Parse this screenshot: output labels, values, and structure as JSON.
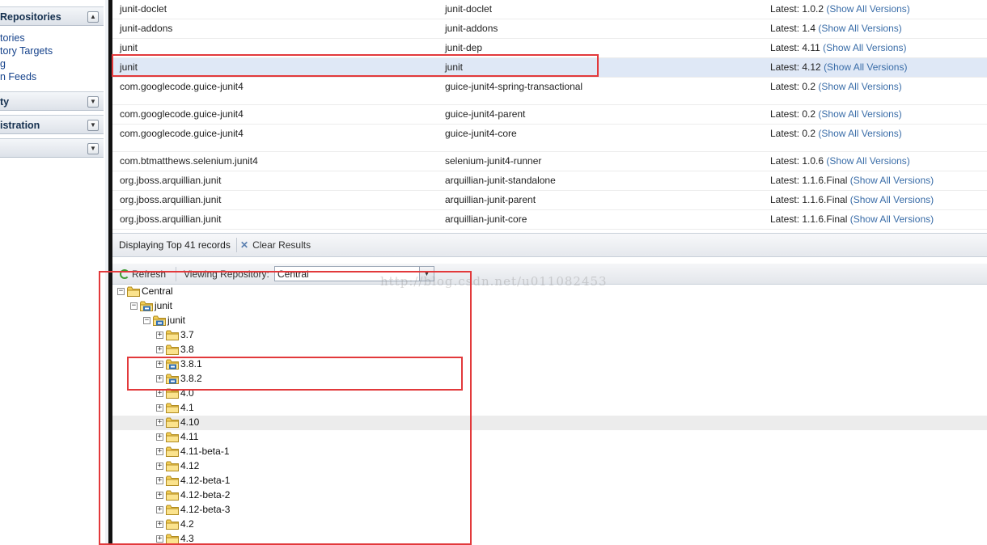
{
  "nav": {
    "repositories_header": "Repositories",
    "links": [
      "tories",
      "tory Targets",
      "g",
      "n Feeds"
    ],
    "security_header": "ty",
    "administration_header": "istration",
    "blank_header": ""
  },
  "results": {
    "latest_prefix": "Latest: ",
    "show_all_label": "(Show All Versions)",
    "rows": [
      {
        "group": "junit-doclet",
        "artifact": "junit-doclet",
        "version": "1.0.2"
      },
      {
        "group": "junit-addons",
        "artifact": "junit-addons",
        "version": "1.4"
      },
      {
        "group": "junit",
        "artifact": "junit-dep",
        "version": "4.11"
      },
      {
        "group": "junit",
        "artifact": "junit",
        "version": "4.12",
        "selected": true
      },
      {
        "group": "com.googlecode.guice-junit4",
        "artifact": "guice-junit4-spring-transactional",
        "version": "0.2"
      },
      {
        "group": "com.googlecode.guice-junit4",
        "artifact": "guice-junit4-parent",
        "version": "0.2"
      },
      {
        "group": "com.googlecode.guice-junit4",
        "artifact": "guice-junit4-core",
        "version": "0.2"
      },
      {
        "group": "com.btmatthews.selenium.junit4",
        "artifact": "selenium-junit4-runner",
        "version": "1.0.6"
      },
      {
        "group": "org.jboss.arquillian.junit",
        "artifact": "arquillian-junit-standalone",
        "version": "1.1.6.Final"
      },
      {
        "group": "org.jboss.arquillian.junit",
        "artifact": "arquillian-junit-parent",
        "version": "1.1.6.Final"
      },
      {
        "group": "org.jboss.arquillian.junit",
        "artifact": "arquillian-junit-core",
        "version": "1.1.6.Final"
      }
    ]
  },
  "paging": {
    "display_text": "Displaying Top 41 records",
    "clear_label": "Clear Results"
  },
  "tree_toolbar": {
    "refresh_label": "Refresh",
    "viewing_label": "Viewing Repository:",
    "repository_value": "Central"
  },
  "tree": {
    "nodes": [
      {
        "label": "Central",
        "depth": 0,
        "expanded": true
      },
      {
        "label": "junit",
        "depth": 1,
        "expanded": true,
        "badge": true
      },
      {
        "label": "junit",
        "depth": 2,
        "expanded": true,
        "badge": true
      },
      {
        "label": "3.7",
        "depth": 3
      },
      {
        "label": "3.8",
        "depth": 3
      },
      {
        "label": "3.8.1",
        "depth": 3,
        "badge": true
      },
      {
        "label": "3.8.2",
        "depth": 3,
        "badge": true
      },
      {
        "label": "4.0",
        "depth": 3
      },
      {
        "label": "4.1",
        "depth": 3
      },
      {
        "label": "4.10",
        "depth": 3,
        "highlight": true
      },
      {
        "label": "4.11",
        "depth": 3
      },
      {
        "label": "4.11-beta-1",
        "depth": 3
      },
      {
        "label": "4.12",
        "depth": 3
      },
      {
        "label": "4.12-beta-1",
        "depth": 3
      },
      {
        "label": "4.12-beta-2",
        "depth": 3
      },
      {
        "label": "4.12-beta-3",
        "depth": 3
      },
      {
        "label": "4.2",
        "depth": 3
      },
      {
        "label": "4.3",
        "depth": 3
      }
    ]
  },
  "watermark": "http://blog.csdn.net/u011082453",
  "colors": {
    "annotation_red": "#e2393b",
    "selected_row": "#dfe8f6",
    "link_blue": "#3a6da8",
    "folder_yellow": "#f3cf56"
  }
}
